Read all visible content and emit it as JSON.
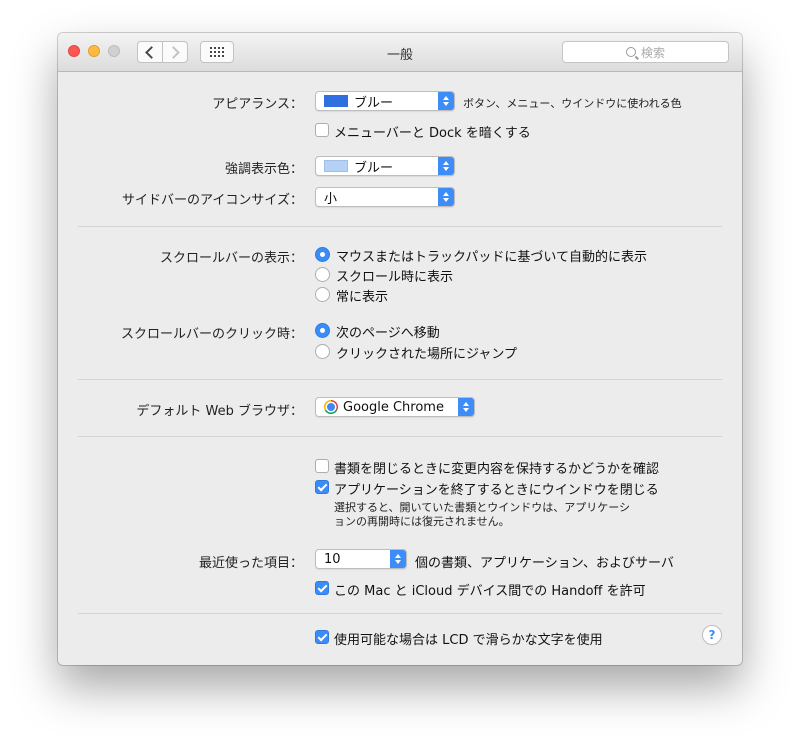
{
  "window": {
    "title": "一般"
  },
  "toolbar": {
    "search_placeholder": "検索"
  },
  "appearance": {
    "label": "アピアランス：",
    "value": "ブルー",
    "swatch_color": "#2f6fe0",
    "note": "ボタン、メニュー、ウインドウに使われる色",
    "dark_menu_label": "メニューバーと Dock を暗くする",
    "dark_menu_checked": false
  },
  "highlight": {
    "label": "強調表示色：",
    "value": "ブルー",
    "swatch_color": "#b5d2f5"
  },
  "sidebar_icon": {
    "label": "サイドバーのアイコンサイズ：",
    "value": "小"
  },
  "scroll_show": {
    "label": "スクロールバーの表示：",
    "options": [
      {
        "label": "マウスまたはトラックパッドに基づいて自動的に表示",
        "selected": true
      },
      {
        "label": "スクロール時に表示",
        "selected": false
      },
      {
        "label": "常に表示",
        "selected": false
      }
    ]
  },
  "scroll_click": {
    "label": "スクロールバーのクリック時：",
    "options": [
      {
        "label": "次のページへ移動",
        "selected": true
      },
      {
        "label": "クリックされた場所にジャンプ",
        "selected": false
      }
    ]
  },
  "browser": {
    "label": "デフォルト Web ブラウザ：",
    "value": "Google Chrome"
  },
  "documents": {
    "ask_keep_label": "書類を閉じるときに変更内容を保持するかどうかを確認",
    "ask_keep_checked": false,
    "close_windows_label": "アプリケーションを終了するときにウインドウを閉じる",
    "close_windows_checked": true,
    "note_line1": "選択すると、開いていた書類とウインドウは、アプリケーシ",
    "note_line2": "ョンの再開時には復元されません。"
  },
  "recent": {
    "label": "最近使った項目：",
    "value": "10",
    "suffix": "個の書類、アプリケーション、およびサーバ",
    "handoff_label": "この Mac と iCloud デバイス間での Handoff を許可",
    "handoff_checked": true
  },
  "lcd": {
    "label": "使用可能な場合は LCD で滑らかな文字を使用",
    "checked": true
  },
  "help": {
    "glyph": "?"
  }
}
